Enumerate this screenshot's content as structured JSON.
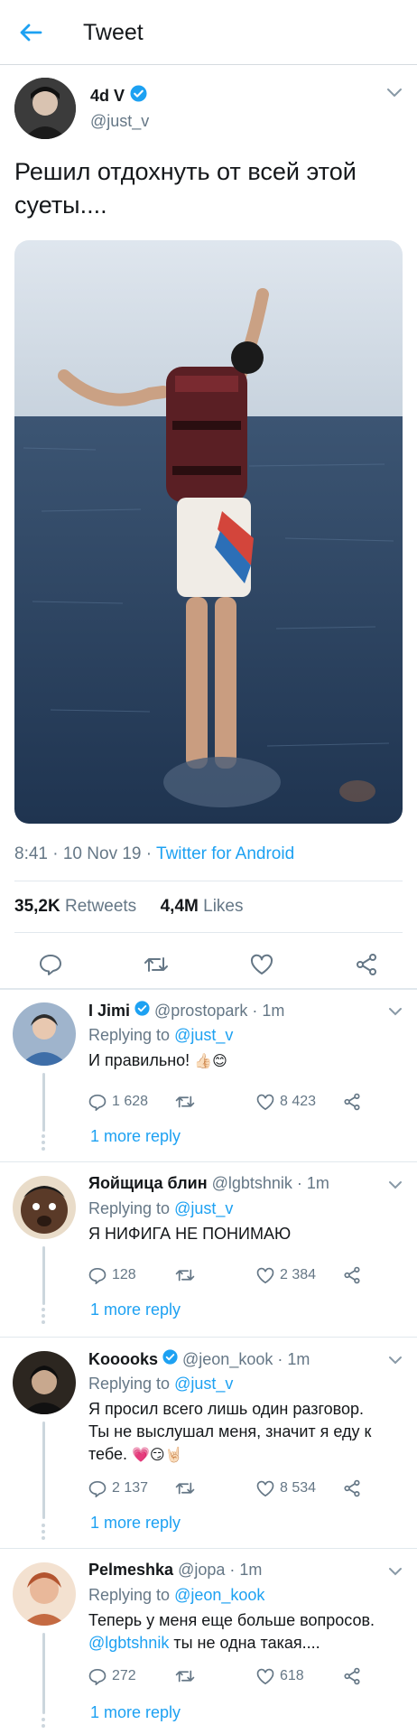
{
  "header": {
    "title": "Tweet"
  },
  "author": {
    "name": "4d V",
    "handle": "@just_v"
  },
  "tweet": {
    "text": "Решил отдохнуть от всей этой суеты....",
    "time": "8:41 · 10 Nov 19 · ",
    "source": "Twitter for Android",
    "retweets_count": "35,2K",
    "retweets_label": "Retweets",
    "likes_count": "4,4M",
    "likes_label": "Likes"
  },
  "replies": [
    {
      "name": "I Jimi",
      "verified": true,
      "handle": "@prostopark · 1m",
      "replying_label": "Replying to",
      "replying_to": "@just_v",
      "text": "И правильно!",
      "emoji": "👍🏻😊",
      "reply_count": "1 628",
      "retweet_count": "",
      "like_count": "8 423",
      "more": "1 more reply"
    },
    {
      "name": "Яойщица блин",
      "verified": false,
      "handle": "@lgbtshnik · 1m",
      "replying_label": "Replying to",
      "replying_to": "@just_v",
      "text": "Я НИФИГА НЕ ПОНИМАЮ",
      "reply_count": "128",
      "retweet_count": "",
      "like_count": "2 384",
      "more": "1 more reply"
    },
    {
      "name": "Kooooks",
      "verified": true,
      "handle": "@jeon_kook · 1m",
      "replying_label": "Replying to",
      "replying_to": "@just_v",
      "text_line1": "Я просил всего лишь один разговор.",
      "text_line2": "Ты не выслушал меня, значит я еду к",
      "text_line3": "тебе.",
      "emoji": "💗😏🤘🏻",
      "reply_count": "2 137",
      "retweet_count": "",
      "like_count": "8 534",
      "more": "1 more reply"
    },
    {
      "name": "Pelmeshka",
      "verified": false,
      "handle": "@jopa · 1m",
      "replying_label": "Replying to",
      "replying_to": "@jeon_kook",
      "text_line1": "Теперь у меня еще больше вопросов.",
      "text_mention": "@lgbtshnik",
      "text_line2": " ты не одна такая....",
      "reply_count": "272",
      "retweet_count": "",
      "like_count": "618",
      "more": "1 more reply"
    }
  ],
  "colors": {
    "accent": "#1da1f2",
    "secondary": "#657786",
    "text": "#14171a",
    "divider": "#e1e8ed"
  },
  "icons": [
    "back-arrow-icon",
    "verified-badge-icon",
    "chevron-down-icon",
    "reply-icon",
    "retweet-icon",
    "like-icon",
    "share-icon"
  ]
}
